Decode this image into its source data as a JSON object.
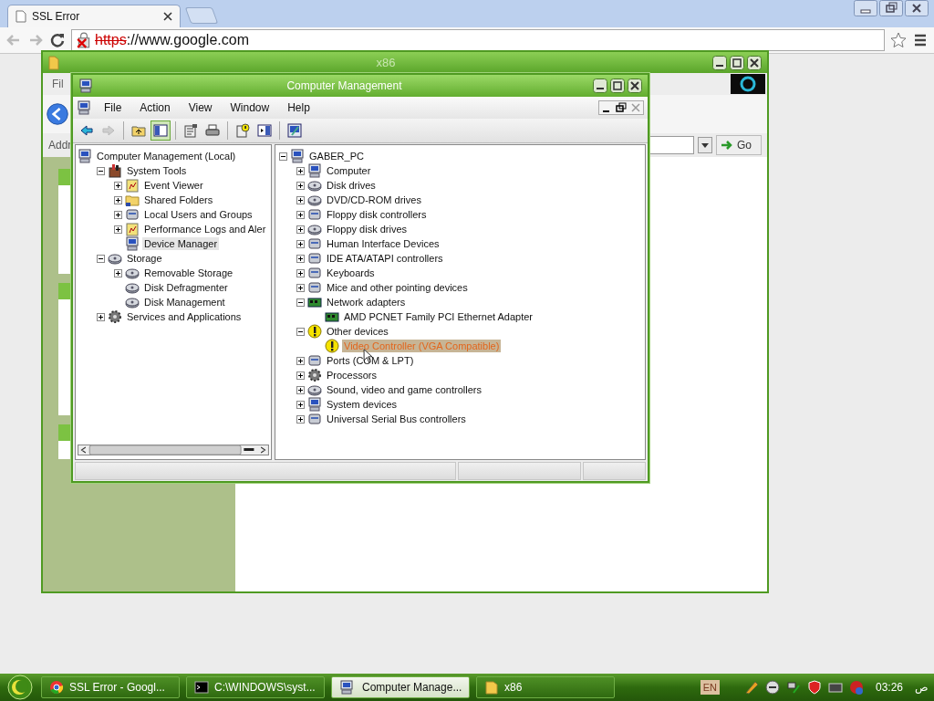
{
  "browser": {
    "tab": {
      "title": "SSL Error",
      "selected": true
    },
    "address": {
      "scheme": "https",
      "rest": "://www.google.com",
      "ssl_error": true
    }
  },
  "x86_window": {
    "title": "x86",
    "menu_item": "Fil",
    "address_label": "Addr",
    "go_button": "Go"
  },
  "cm_window": {
    "title": "Computer Management",
    "menu": [
      "File",
      "Action",
      "View",
      "Window",
      "Help"
    ],
    "toolbar": [
      {
        "kind": "back",
        "disabled": false,
        "pressed": false
      },
      {
        "kind": "forward",
        "disabled": true,
        "pressed": false
      },
      {
        "kind": "up",
        "disabled": false,
        "pressed": false
      },
      {
        "kind": "tree",
        "disabled": false,
        "pressed": true
      },
      {
        "kind": "properties",
        "disabled": false,
        "pressed": false
      },
      {
        "kind": "print",
        "disabled": false,
        "pressed": false
      },
      {
        "kind": "help",
        "disabled": false,
        "pressed": false
      },
      {
        "kind": "pane",
        "disabled": false,
        "pressed": false
      },
      {
        "kind": "console",
        "disabled": false,
        "pressed": false
      }
    ],
    "left_tree": [
      {
        "label": "Computer Management (Local)",
        "kind": "computer",
        "selected": false,
        "children": [
          {
            "label": "System Tools",
            "kind": "toolbox",
            "expanded": true,
            "selected": false,
            "children": [
              {
                "label": "Event Viewer",
                "kind": "log",
                "expanded": false,
                "selected": false
              },
              {
                "label": "Shared Folders",
                "kind": "folder",
                "expanded": false,
                "selected": false
              },
              {
                "label": "Local Users and Groups",
                "kind": "device",
                "expanded": false,
                "selected": false
              },
              {
                "label": "Performance Logs and Aler",
                "kind": "log",
                "expanded": false,
                "selected": false
              },
              {
                "label": "Device Manager",
                "kind": "computer",
                "selected": true
              }
            ]
          },
          {
            "label": "Storage",
            "kind": "disk",
            "expanded": true,
            "selected": false,
            "children": [
              {
                "label": "Removable Storage",
                "kind": "disk",
                "expanded": false,
                "selected": false
              },
              {
                "label": "Disk Defragmenter",
                "kind": "disk",
                "selected": false
              },
              {
                "label": "Disk Management",
                "kind": "disk",
                "selected": false
              }
            ]
          },
          {
            "label": "Services and Applications",
            "kind": "gear",
            "expanded": false,
            "selected": false
          }
        ]
      }
    ],
    "right_tree": [
      {
        "label": "GABER_PC",
        "kind": "computer",
        "expanded": true,
        "selected": false,
        "children": [
          {
            "label": "Computer",
            "kind": "computer",
            "expanded": false,
            "selected": false
          },
          {
            "label": "Disk drives",
            "kind": "disk",
            "expanded": false,
            "selected": false
          },
          {
            "label": "DVD/CD-ROM drives",
            "kind": "disk",
            "expanded": false,
            "selected": false
          },
          {
            "label": "Floppy disk controllers",
            "kind": "device",
            "expanded": false,
            "selected": false
          },
          {
            "label": "Floppy disk drives",
            "kind": "disk",
            "expanded": false,
            "selected": false
          },
          {
            "label": "Human Interface Devices",
            "kind": "device",
            "expanded": false,
            "selected": false
          },
          {
            "label": "IDE ATA/ATAPI controllers",
            "kind": "device",
            "expanded": false,
            "selected": false
          },
          {
            "label": "Keyboards",
            "kind": "device",
            "expanded": false,
            "selected": false
          },
          {
            "label": "Mice and other pointing devices",
            "kind": "device",
            "expanded": false,
            "selected": false
          },
          {
            "label": "Network adapters",
            "kind": "network",
            "expanded": true,
            "selected": false,
            "children": [
              {
                "label": "AMD PCNET Family PCI Ethernet Adapter",
                "kind": "network",
                "selected": false
              }
            ]
          },
          {
            "label": "Other devices",
            "kind": "warning",
            "expanded": true,
            "selected": false,
            "children": [
              {
                "label": "Video Controller (VGA Compatible)",
                "kind": "warning",
                "selected": true
              }
            ]
          },
          {
            "label": "Ports (COM & LPT)",
            "kind": "device",
            "expanded": false,
            "selected": false
          },
          {
            "label": "Processors",
            "kind": "gear",
            "expanded": false,
            "selected": false
          },
          {
            "label": "Sound, video and game controllers",
            "kind": "disk",
            "expanded": false,
            "selected": false
          },
          {
            "label": "System devices",
            "kind": "computer",
            "expanded": false,
            "selected": false
          },
          {
            "label": "Universal Serial Bus controllers",
            "kind": "device",
            "expanded": false,
            "selected": false
          }
        ]
      }
    ]
  },
  "taskbar": {
    "buttons": [
      {
        "label": "SSL Error - Googl...",
        "kind": "browser",
        "selected": false
      },
      {
        "label": "C:\\WINDOWS\\syst...",
        "kind": "console",
        "selected": false
      },
      {
        "label": "Computer Manage...",
        "kind": "computer",
        "selected": true
      },
      {
        "label": "x86",
        "kind": "folder",
        "selected": false
      }
    ],
    "language": "EN",
    "clock": "03:26",
    "clock_suffix": "ص"
  }
}
